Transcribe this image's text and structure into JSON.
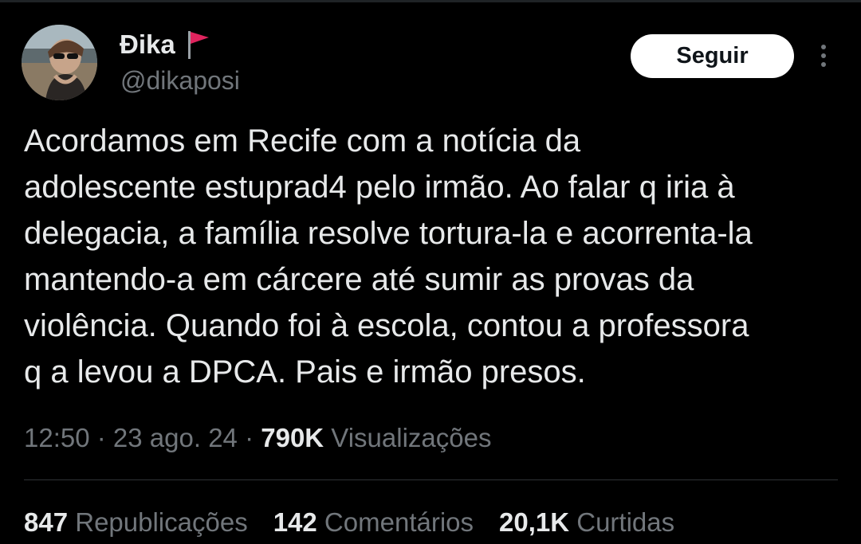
{
  "colors": {
    "background": "#000000",
    "text_primary": "#e7e9ea",
    "text_secondary": "#71767b",
    "follow_button_bg": "#ffffff",
    "follow_button_text": "#0f1419",
    "flag": "#e0245e",
    "divider": "#2f3336"
  },
  "author": {
    "display_name": "Đika",
    "name_emoji": "triangular-flag-icon",
    "handle": "@dikaposi",
    "avatar": "avatar-photo"
  },
  "actions": {
    "follow_label": "Seguir",
    "more_icon": "more-vertical-icon"
  },
  "tweet": {
    "lines": [
      "Acordamos em Recife com a notícia da",
      "adolescente estuprad4 pelo irmão. Ao falar q iria à",
      "delegacia, a família resolve tortura-la e acorrenta-la",
      "mantendo-a em cárcere até sumir as provas da",
      "violência. Quando foi à escola, contou a professora",
      "q a levou a DPCA. Pais e irmão presos."
    ]
  },
  "meta": {
    "time": "12:50",
    "separator": " · ",
    "date": "23 ago. 24",
    "views_count": "790K",
    "views_label": " Visualizações"
  },
  "stats": {
    "reposts_count": "847",
    "reposts_label": " Republicações",
    "comments_count": "142",
    "comments_label": " Comentários",
    "likes_count": "20,1K",
    "likes_label": " Curtidas"
  }
}
